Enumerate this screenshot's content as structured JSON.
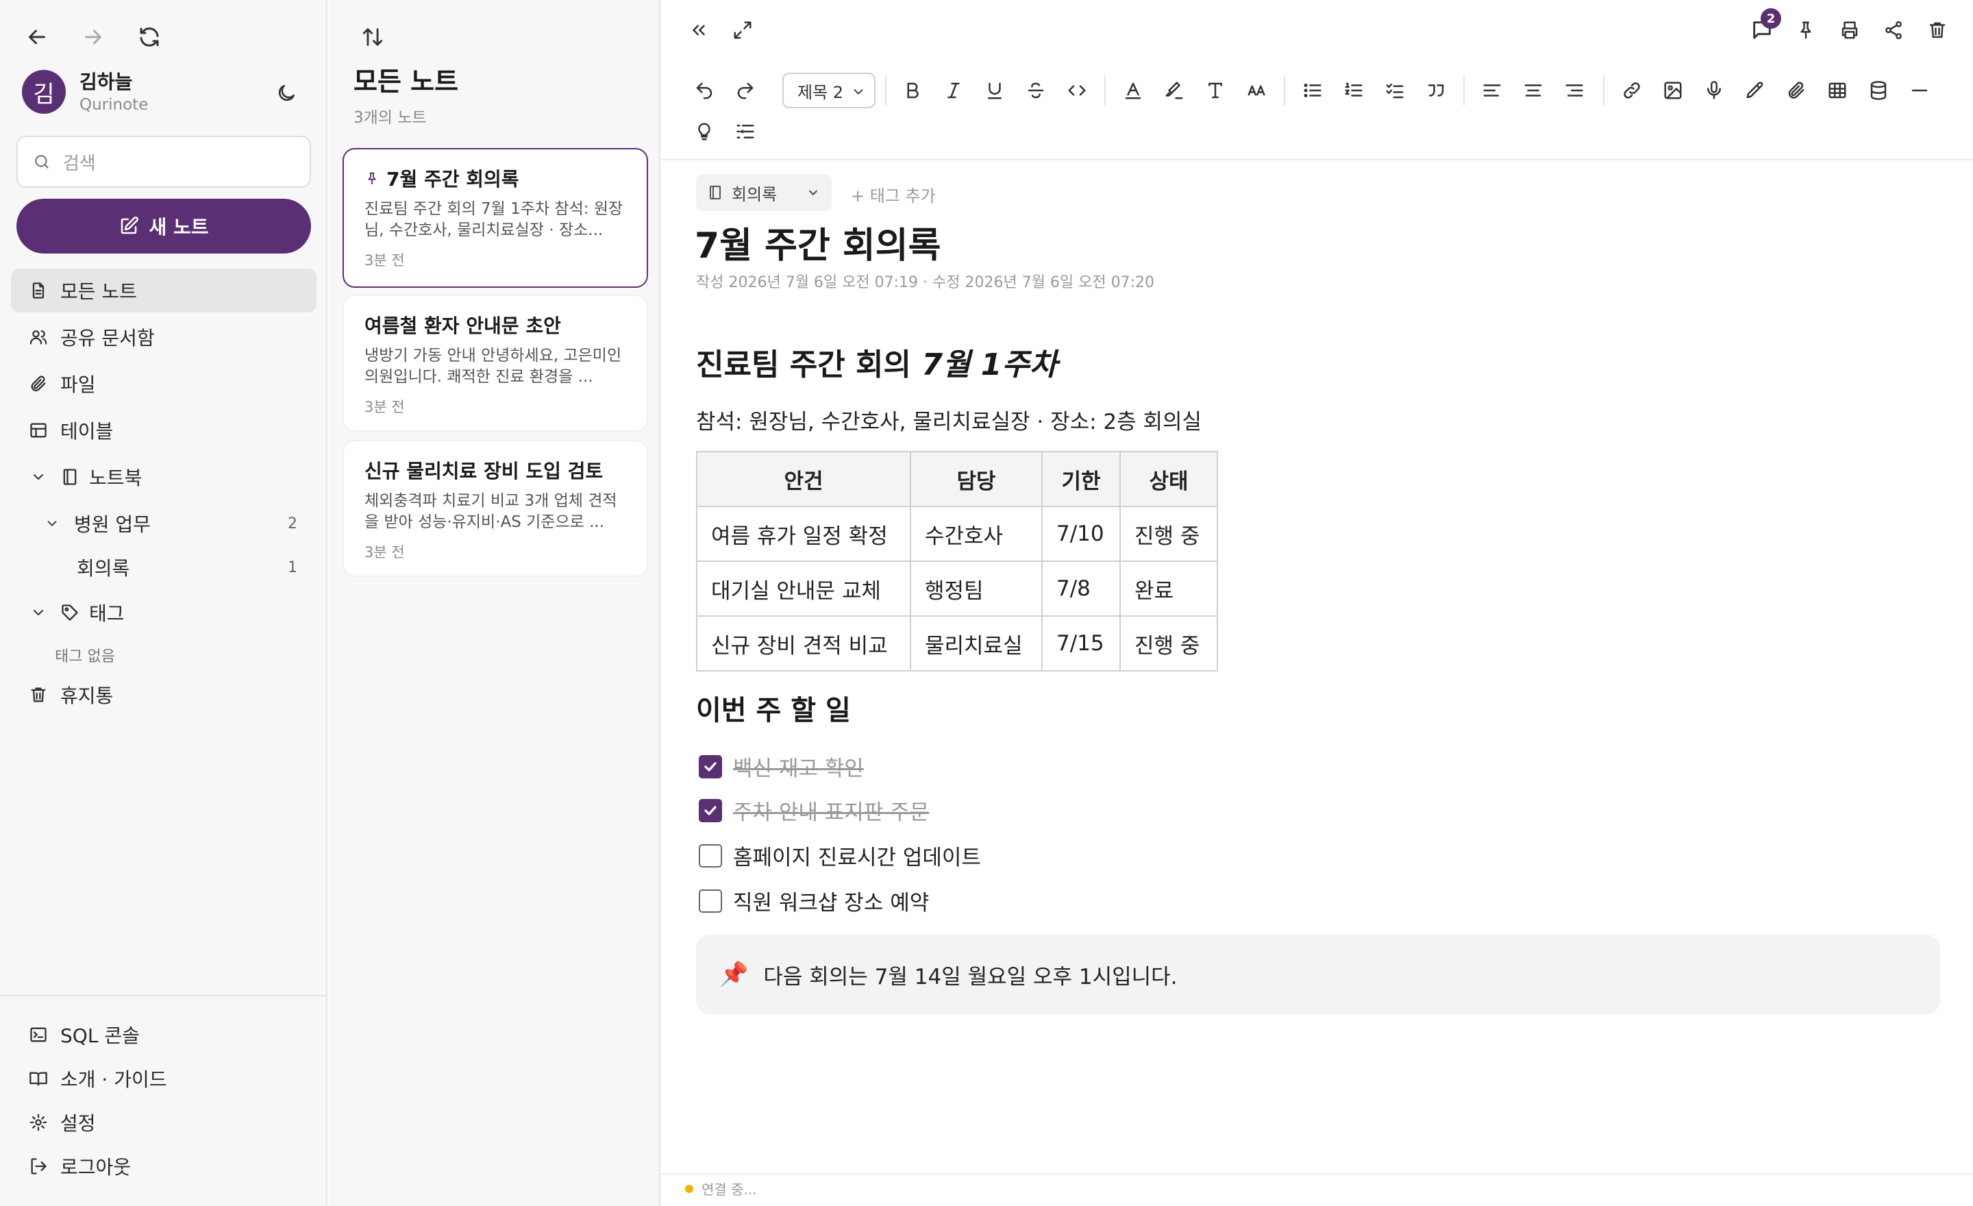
{
  "user": {
    "initial": "김",
    "name": "김하늘",
    "app": "Qurinote"
  },
  "search": {
    "placeholder": "검색"
  },
  "sidebar": {
    "new_note_label": "새 노트",
    "items": [
      {
        "label": "모든 노트",
        "icon": "document-icon"
      },
      {
        "label": "공유 문서함",
        "icon": "users-icon"
      },
      {
        "label": "파일",
        "icon": "paperclip-icon"
      },
      {
        "label": "테이블",
        "icon": "table-icon"
      },
      {
        "label": "노트북",
        "icon": "notebook-icon"
      },
      {
        "label": "병원 업무",
        "count": "2"
      },
      {
        "label": "회의록",
        "count": "1"
      },
      {
        "label": "태그",
        "icon": "tag-icon"
      },
      {
        "label": "태그 없음"
      },
      {
        "label": "휴지통",
        "icon": "trash-icon"
      }
    ],
    "bottom": [
      {
        "label": "SQL 콘솔",
        "icon": "terminal-icon"
      },
      {
        "label": "소개 · 가이드",
        "icon": "book-icon"
      },
      {
        "label": "설정",
        "icon": "gear-icon"
      },
      {
        "label": "로그아웃",
        "icon": "logout-icon"
      }
    ]
  },
  "note_list": {
    "title": "모든 노트",
    "count": "3개의 노트",
    "notes": [
      {
        "title": "7월 주간 회의록",
        "preview": "진료팀 주간 회의 7월 1주차 참석: 원장님, 수간호사, 물리치료실장 · 장소...",
        "time": "3분 전",
        "pinned": true
      },
      {
        "title": "여름철 환자 안내문 초안",
        "preview": "냉방기 가동 안내 안녕하세요, 고은미인의원입니다. 쾌적한 진료 환경을 ...",
        "time": "3분 전"
      },
      {
        "title": "신규 물리치료 장비 도입 검토",
        "preview": "체외충격파 치료기 비교 3개 업체 견적을 받아 성능·유지비·AS 기준으로 ...",
        "time": "3분 전"
      }
    ]
  },
  "editor": {
    "comment_count": "2",
    "heading_select": "제목 2",
    "notebook_chip": "회의록",
    "add_tag": "+ 태그 추가",
    "title": "7월 주간 회의록",
    "meta": "작성 2026년 7월 6일 오전 07:19 · 수정 2026년 7월 6일 오전 07:20",
    "status": "연결 중..."
  },
  "doc": {
    "h2_plain": "진료팀 주간 회의",
    "h2_italic": "7월 1주차",
    "attendees": "참석: 원장님, 수간호사, 물리치료실장 · 장소: 2층 회의실",
    "table": {
      "headers": [
        "안건",
        "담당",
        "기한",
        "상태"
      ],
      "rows": [
        [
          "여름 휴가 일정 확정",
          "수간호사",
          "7/10",
          "진행 중"
        ],
        [
          "대기실 안내문 교체",
          "행정팀",
          "7/8",
          "완료"
        ],
        [
          "신규 장비 견적 비교",
          "물리치료실",
          "7/15",
          "진행 중"
        ]
      ]
    },
    "h3": "이번 주 할 일",
    "todos": [
      {
        "text": "백신 재고 확인",
        "done": true
      },
      {
        "text": "주차 안내 표지판 주문",
        "done": true
      },
      {
        "text": "홈페이지 진료시간 업데이트",
        "done": false
      },
      {
        "text": "직원 워크샵 장소 예약",
        "done": false
      }
    ],
    "callout_icon": "📌",
    "callout": "다음 회의는 7월 14일 월요일 오후 1시입니다."
  },
  "colors": {
    "accent": "#5b2f73",
    "status_connecting": "#f0b400"
  }
}
